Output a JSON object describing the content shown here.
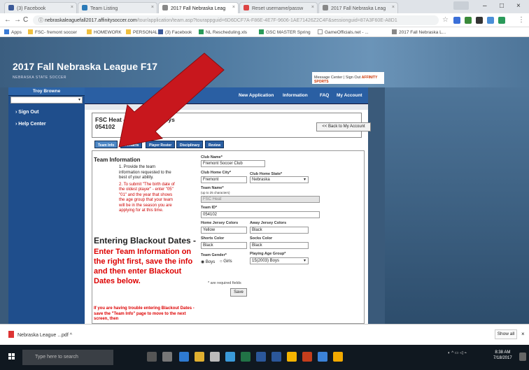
{
  "browser": {
    "tabs": [
      {
        "label": "(3) Facebook"
      },
      {
        "label": "Team Listing"
      },
      {
        "label": "2017 Fall Nebraska Leag"
      },
      {
        "label": "Reset username/passw"
      },
      {
        "label": "2017 Fall Nebraska Leag"
      }
    ],
    "url_main": "nebraskaleaguefall2017.affinitysoccer.com",
    "url_path": "/tour/application/team.asp?tourappguid=6D6DCF7A-F86E-4E7F-9606-1AE71426Z2C4F&sessionguid=87A3F60E-A8D1",
    "bookmarks": [
      "Apps",
      "FSC- fremont soccer",
      "HOMEWORK",
      "PERSONAL",
      "(3) Facebook",
      "NL Rescheduling.xls",
      "GSC MASTER Spring",
      "GameOfficials.net - ...",
      "2017 Fall Nebraska L..."
    ]
  },
  "site": {
    "title": "2017 Fall Nebraska League F17",
    "subtitle": "NEBRASKA STATE SOCCER",
    "message_center": "Message Center | Sign Out",
    "brand": "AFFINITY SPORTS"
  },
  "sidebar": {
    "user": "Troy Browne",
    "items": [
      {
        "label": "Sign Out"
      },
      {
        "label": "Help Center"
      }
    ]
  },
  "topnav": {
    "items": [
      {
        "label": "New Application"
      },
      {
        "label": "Information"
      },
      {
        "label": "FAQ"
      },
      {
        "label": "My Account"
      }
    ]
  },
  "team_header": {
    "title": "FSC Heat - F...15(2003) Boys",
    "code": "054102",
    "back_label": "<< Back to My Account"
  },
  "subtabs": [
    {
      "label": "Team Info"
    },
    {
      "label": "Contacts"
    },
    {
      "label": "Player Roster"
    },
    {
      "label": "Disciplinary"
    },
    {
      "label": "Review"
    }
  ],
  "info": {
    "heading": "Team Information",
    "step1": "1. Provide the team information requested to the best of your ability.",
    "step2": "2. To submit \"The birth date of the oldest player\" - enter \"05\" \"01\" and the year that shows the age group that your team will be in the season you are applying for at this time.",
    "blackout_heading": "Entering Blackout Dates -",
    "blackout_red": "Enter Team Information on the right first, save the info and then enter Blackout Dates below.",
    "trouble": "If you are having trouble entering Blackout Dates - save the \"Team Info\" page to move to the next screen, then"
  },
  "form": {
    "club_name_label": "Club Name*",
    "club_name": "Fremont Soccer Club",
    "club_city_label": "Club Home City*",
    "club_city": "Fremont",
    "club_state_label": "Club Home State*",
    "club_state": "Nebraska",
    "team_name_label": "Team Name*",
    "team_name_note": "(up to 25 characters)",
    "team_name": "FSC Heat",
    "team_id_label": "Team ID*",
    "team_id": "054102",
    "home_colors_label": "Home Jersey Colors",
    "home_colors": "Yellow",
    "away_colors_label": "Away Jersey Colors",
    "away_colors": "Black",
    "shorts_label": "Shorts Color",
    "shorts": "Black",
    "socks_label": "Socks Color",
    "socks": "Black",
    "gender_label": "Team Gender*",
    "gender_boys": "Boys",
    "gender_girls": "Girls",
    "age_group_label": "Playing Age Group*",
    "age_group": "15(2003) Boys",
    "required_note": "* are required fields",
    "save_label": "Save"
  },
  "downloads": {
    "file": "Nebraska League ...pdf",
    "show_all": "Show all"
  },
  "taskbar": {
    "search_placeholder": "Type here to search",
    "time": "8:38 AM",
    "date": "7/18/2017"
  }
}
